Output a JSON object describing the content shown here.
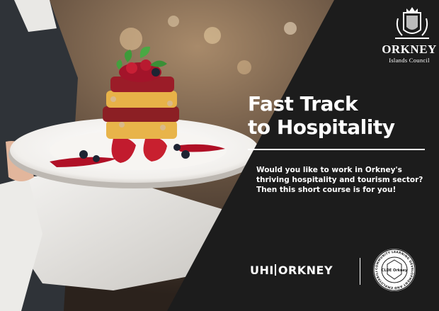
{
  "council": {
    "name": "ORKNEY",
    "subtitle": "Islands Council",
    "crest": "heraldic-crest-icon"
  },
  "headline": {
    "line1": "Fast Track",
    "line2": "to Hospitality"
  },
  "blurb": "Would you like to work in Orkney's thriving hospitality and tourism sector? Then this short course is for you!",
  "partner_logo": {
    "left": "UHI",
    "right": "ORKNEY"
  },
  "cld_badge": {
    "center": "CLDE Orkney",
    "ring": "COMMUNITY LEARNING DEVELOPMENT AND EMPLOYABILITY"
  },
  "colors": {
    "panel": "#1c1c1c",
    "plate": "#f4f2ef",
    "sauce": "#b01026",
    "text": "#ffffff"
  }
}
